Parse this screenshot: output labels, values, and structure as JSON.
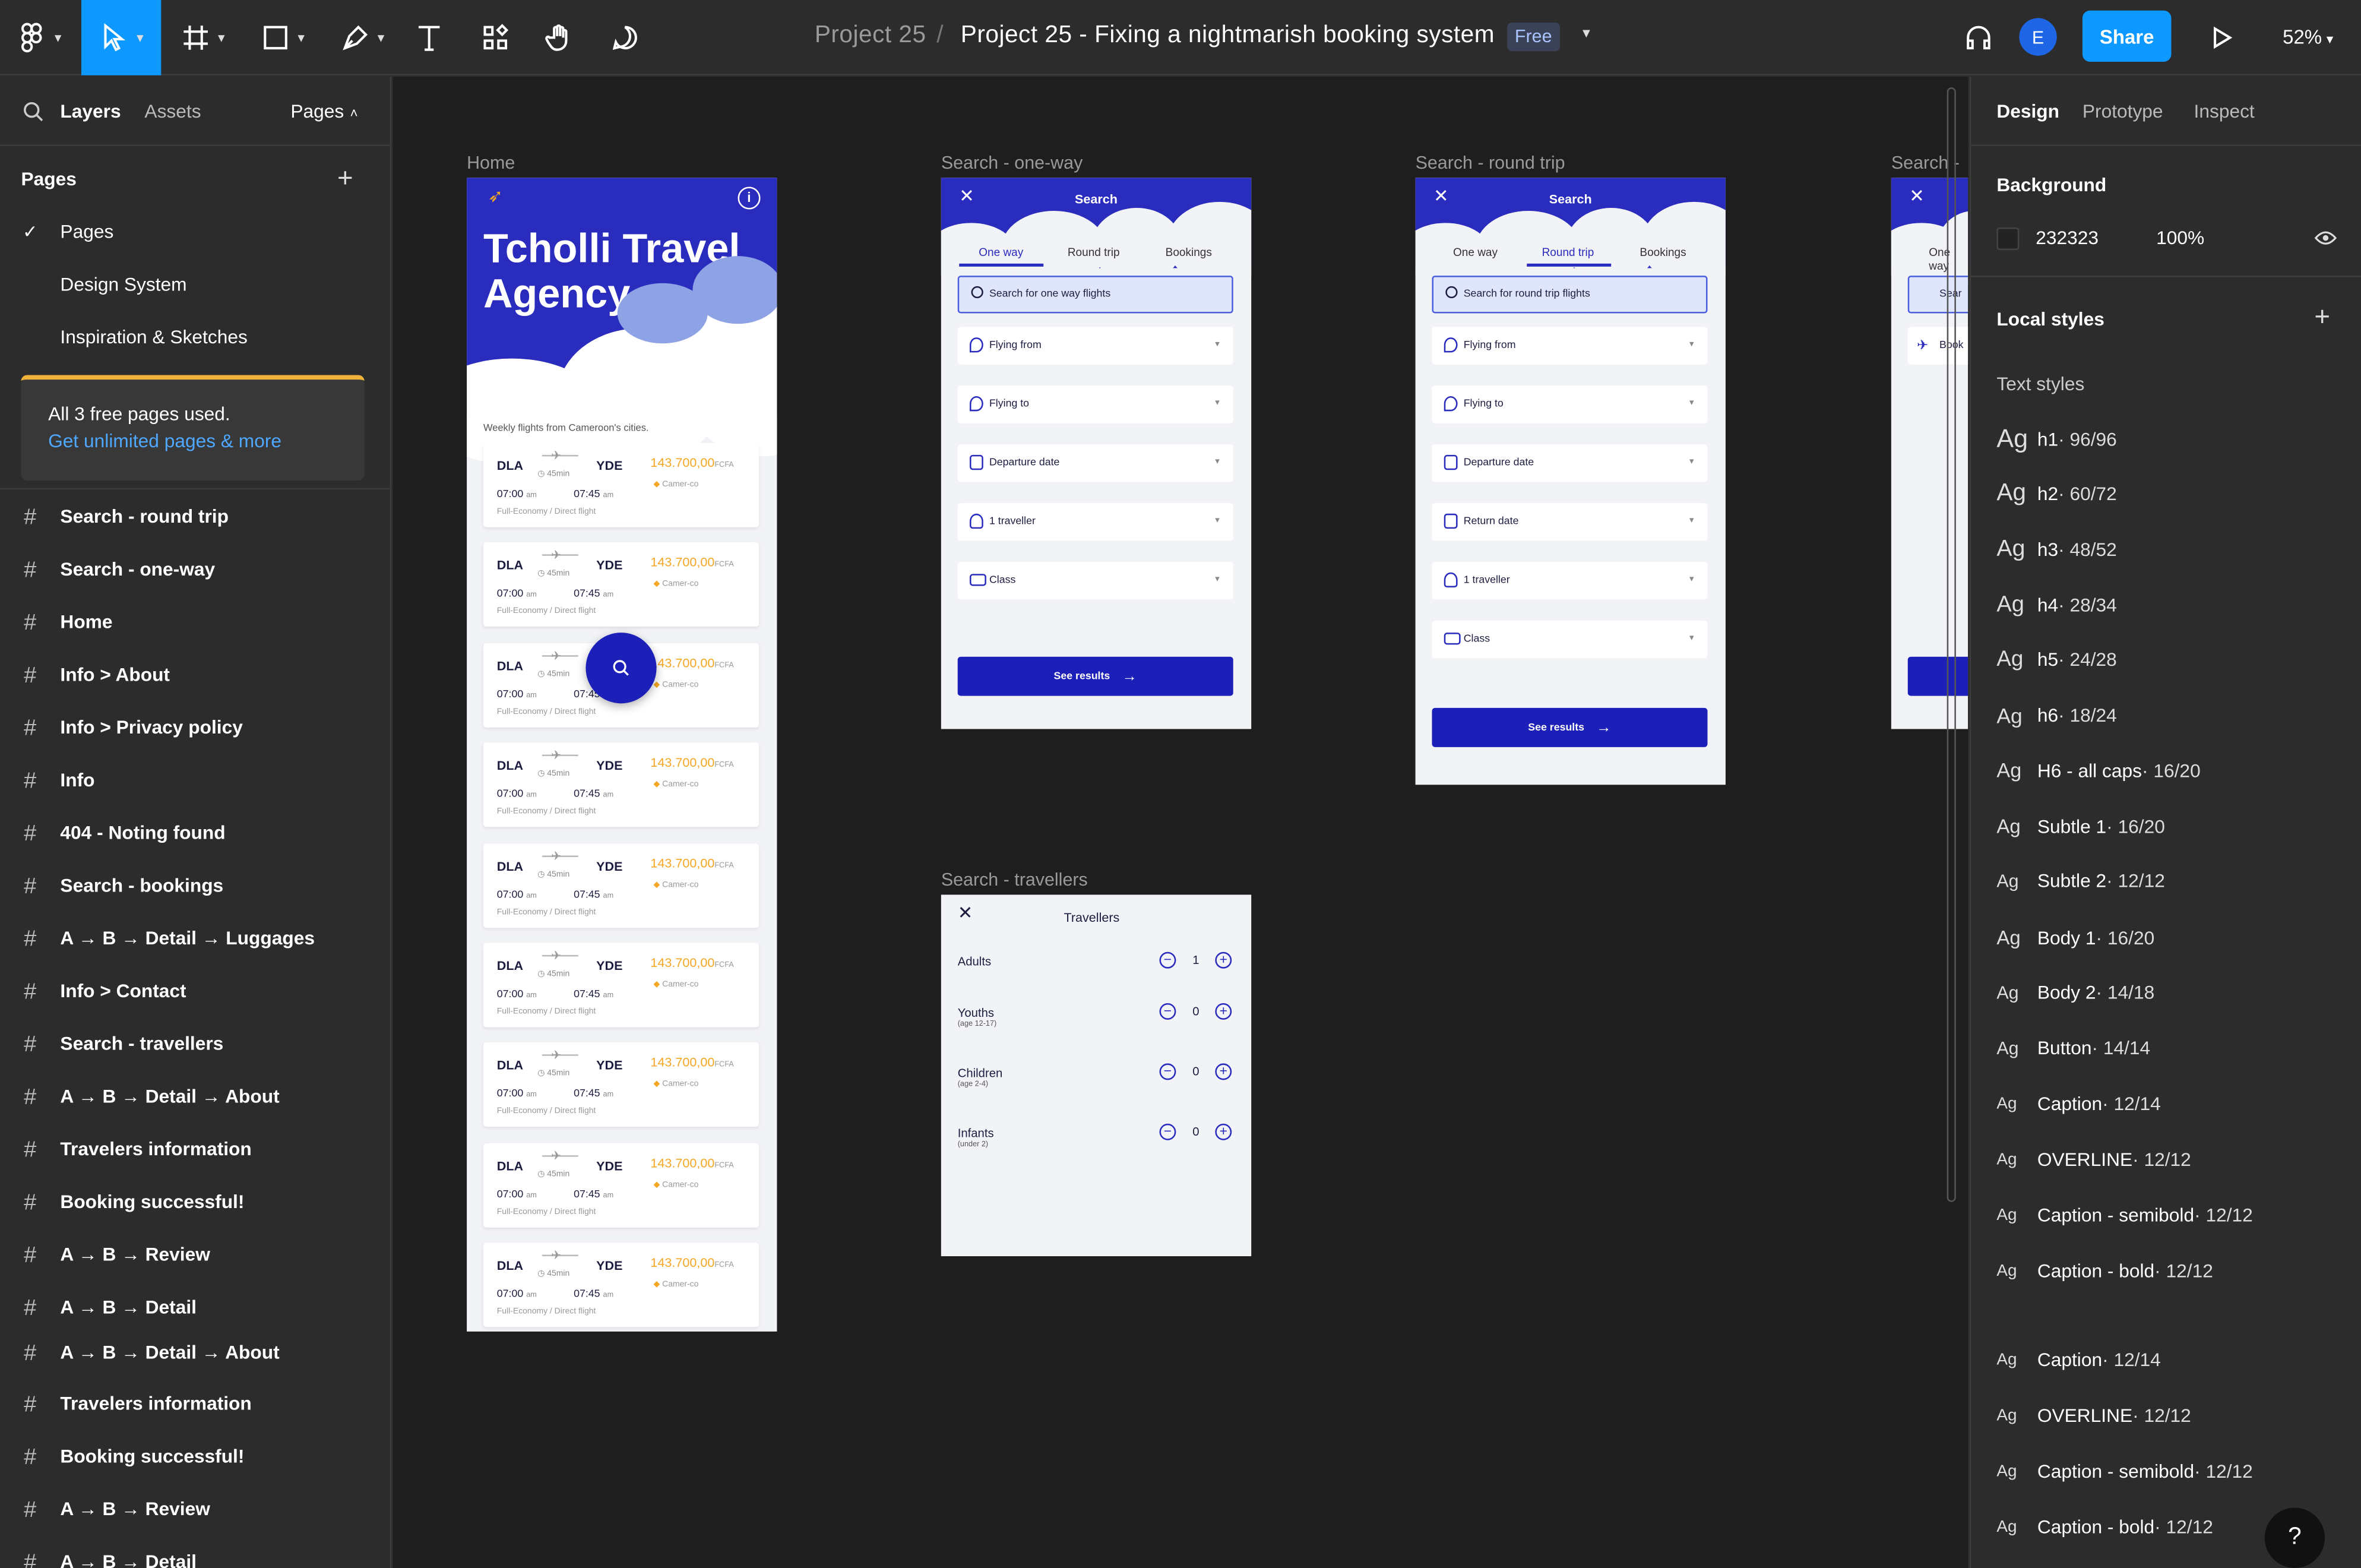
{
  "toolbar": {
    "breadcrumb_project": "Project 25",
    "separator": "/",
    "file_title": "Project 25 - Fixing a nightmarish booking system",
    "plan_badge": "Free",
    "avatar_letter": "E",
    "share_label": "Share",
    "zoom": "52%",
    "accent": "#0d99ff"
  },
  "left_panel": {
    "tabs": [
      "Layers",
      "Assets"
    ],
    "pages_toggle": "Pages",
    "pages_heading": "Pages",
    "pages": [
      "Pages",
      "Design System",
      "Inspiration & Sketches"
    ],
    "notice_title": "All 3 free pages used.",
    "notice_link": "Get unlimited pages & more",
    "layers": [
      "Search - round trip",
      "Search - one-way",
      "Home",
      "Info > About",
      "Info > Privacy policy",
      "Info",
      "404 - Noting found",
      "Search - bookings",
      "A → B → Detail → Luggages",
      "Info > Contact",
      "Search - travellers",
      "A → B → Detail → About",
      "Travelers information",
      "Booking successful!",
      "A → B → Review",
      "A → B → Detail",
      "A → B → Detail → About",
      "Travelers information",
      "Booking successful!",
      "A → B → Review",
      "A → B → Detail"
    ]
  },
  "canvas": {
    "frame_labels": [
      "Home",
      "Search - one-way",
      "Search - round trip",
      "Search -",
      "Search - travellers"
    ],
    "home": {
      "title_line1": "Tcholli Travel",
      "title_line2": "Agency.",
      "subtitle": "Weekly flights from Cameroon's cities.",
      "flight": {
        "from": "DLA",
        "to": "YDE",
        "price": "143.700,00",
        "currency": "FCFA",
        "duration": "45min",
        "dep": "07:00",
        "arr": "07:45",
        "ampm": "am",
        "airline": "Camer-co",
        "class": "Full-Economy / Direct flight"
      }
    },
    "search_common": {
      "title": "Search",
      "tab_one_way": "One way",
      "tab_round_trip": "Round trip",
      "tab_bookings": "Bookings",
      "flying_from": "Flying from",
      "flying_to": "Flying to",
      "departure": "Departure date",
      "return": "Return date",
      "travellers": "1 traveller",
      "class": "Class",
      "see_results": "See results",
      "search_one_way": "Search for one way flights",
      "search_round_trip": "Search for round trip flights",
      "bookings_partial": "Book",
      "search_partial": "Sear"
    },
    "travellers": {
      "title": "Travellers",
      "adults": "Adults",
      "adults_count": "1",
      "youths": "Youths",
      "youths_note": "(age 12-17)",
      "youths_count": "0",
      "children": "Children",
      "children_note": "(age 2-4)",
      "children_count": "0",
      "infants": "Infants",
      "infants_note": "(under 2)",
      "infants_count": "0"
    },
    "brand_blue": "#2a2cbe"
  },
  "right_panel": {
    "tabs": [
      "Design",
      "Prototype",
      "Inspect"
    ],
    "background_heading": "Background",
    "bg_hex": "232323",
    "bg_opacity": "100%",
    "local_styles": "Local styles",
    "text_styles": "Text styles",
    "styles": [
      {
        "ag": "Ag",
        "name": "h1",
        "meta": " · 96/96"
      },
      {
        "ag": "Ag",
        "name": "h2",
        "meta": " · 60/72"
      },
      {
        "ag": "Ag",
        "name": "h3",
        "meta": " · 48/52"
      },
      {
        "ag": "Ag",
        "name": "h4",
        "meta": " · 28/34"
      },
      {
        "ag": "Ag",
        "name": "h5",
        "meta": " · 24/28"
      },
      {
        "ag": "Ag",
        "name": "h6",
        "meta": " · 18/24"
      },
      {
        "ag": "Ag",
        "name": "H6 - all caps",
        "meta": " · 16/20"
      },
      {
        "ag": "Ag",
        "name": "Subtle 1",
        "meta": " · 16/20"
      },
      {
        "ag": "Ag",
        "name": "Subtle 2",
        "meta": " · 12/12"
      },
      {
        "ag": "Ag",
        "name": "Body 1",
        "meta": " · 16/20"
      },
      {
        "ag": "Ag",
        "name": "Body 2",
        "meta": " · 14/18"
      },
      {
        "ag": "Ag",
        "name": "Button",
        "meta": " · 14/14"
      },
      {
        "ag": "Ag",
        "name": "Caption",
        "meta": " · 12/14"
      },
      {
        "ag": "Ag",
        "name": "OVERLINE",
        "meta": " · 12/12"
      },
      {
        "ag": "Ag",
        "name": "Caption - semibold",
        "meta": " · 12/12"
      },
      {
        "ag": "Ag",
        "name": "Caption - bold",
        "meta": " · 12/12"
      },
      {
        "ag": "Ag",
        "name": "Caption",
        "meta": " · 12/14"
      },
      {
        "ag": "Ag",
        "name": "OVERLINE",
        "meta": " · 12/12"
      },
      {
        "ag": "Ag",
        "name": "Caption - semibold",
        "meta": " · 12/12"
      },
      {
        "ag": "Ag",
        "name": "Caption - bold",
        "meta": " · 12/12"
      }
    ],
    "help": "?"
  }
}
